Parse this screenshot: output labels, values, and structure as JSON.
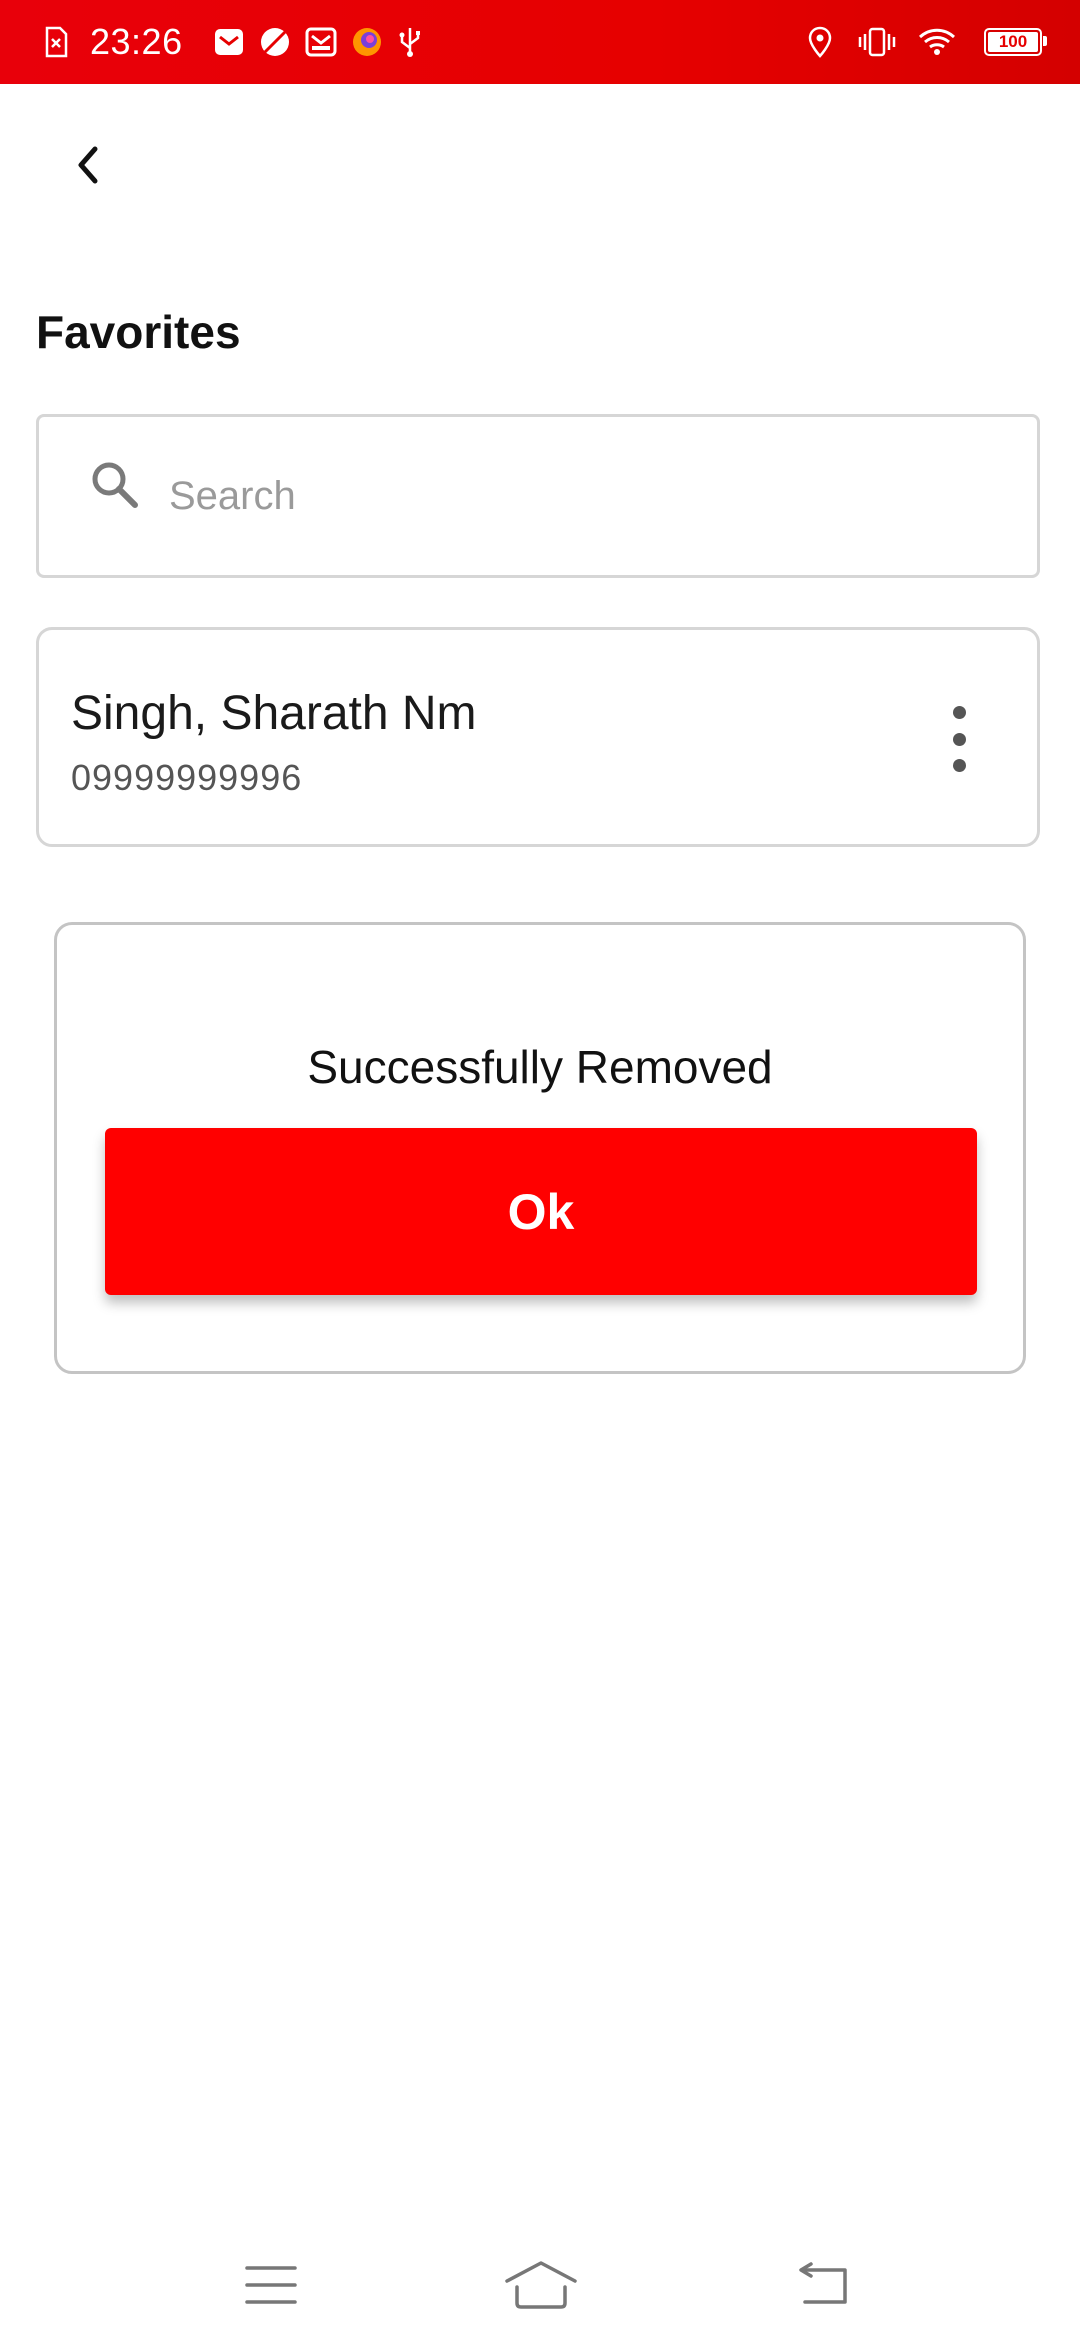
{
  "status_bar": {
    "time": "23:26",
    "battery_level": "100",
    "icons_left": [
      "sim-error-icon",
      "mail-app-icon",
      "leaf-app-icon",
      "message-app-icon",
      "firefox-icon",
      "usb-icon"
    ],
    "icons_right": [
      "location-icon",
      "vibrate-icon",
      "wifi-icon",
      "battery-icon"
    ],
    "background_color": "#e60000"
  },
  "header": {
    "back_icon": "chevron-left-icon",
    "title": "Favorites"
  },
  "search": {
    "icon": "search-icon",
    "placeholder": "Search",
    "value": ""
  },
  "contacts": [
    {
      "name": "Singh, Sharath Nm",
      "phone": "09999999996",
      "menu_icon": "more-vertical-icon"
    }
  ],
  "dialog": {
    "message": "Successfully Removed",
    "ok_label": "Ok",
    "accent_color": "#ff0000"
  },
  "nav_bar": {
    "items": [
      "menu-icon",
      "home-icon",
      "back-icon"
    ]
  }
}
